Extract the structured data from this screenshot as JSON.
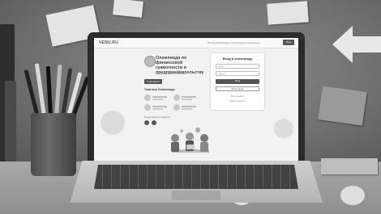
{
  "site": {
    "logo": "VENU.RU",
    "top_links": "Методический раздел   Олимпиадная информация",
    "top_button": "Вход"
  },
  "hero": {
    "title": "Олимпиада по финансовой грамотности и предпринимательству",
    "subtitle": "для учащихся 1-11 классов",
    "date_badge": "5-25 марта",
    "topics_title": "Тематика Олимпиады",
    "share_label": "Поделиться в соцсетях"
  },
  "login": {
    "title": "Вход в олимпиаду",
    "login_placeholder": "Логин",
    "password_placeholder": "Пароль",
    "submit_label": "Вход",
    "register_label": "Регистрация",
    "forgot_label": "Восстановить",
    "other_label": "Забыли пароль?"
  },
  "colors": {
    "accent": "#555555",
    "screen_bg": "#f2f2f2"
  }
}
